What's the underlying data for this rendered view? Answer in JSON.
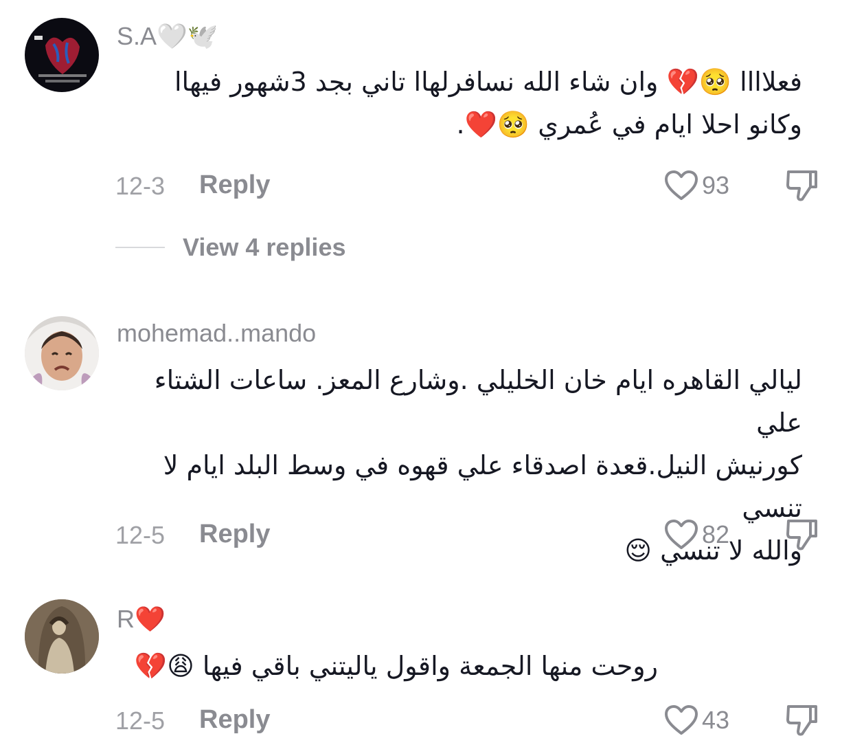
{
  "comments": [
    {
      "username": "S.A🤍🕊️",
      "text_line1": "فعلاااا 🥺💔 وان شاء الله نسافرلهاا تاني بجد 3شهور فيهاا",
      "text_line2": "وكانو احلا ايام في عُمري 🥺❤️.",
      "date": "12-3",
      "reply_label": "Reply",
      "likes": "93",
      "view_replies": "View 4 replies"
    },
    {
      "username": "mohemad..mando",
      "text_line1": "ليالي القاهره ايام خان الخليلي .وشارع المعز. ساعات الشتاء علي",
      "text_line2": "كورنيش النيل.قعدة اصدقاء علي قهوه في وسط البلد ايام لا تنسي",
      "text_line3": "والله لا تنسي 😌",
      "date": "12-5",
      "reply_label": "Reply",
      "likes": "82"
    },
    {
      "username": "R❤️",
      "text_line1": "روحت منها الجمعة واقول ياليتني باقي فيها 😩💔",
      "date": "12-5",
      "reply_label": "Reply",
      "likes": "43"
    }
  ],
  "icons": {
    "like": "heart-outline-icon",
    "dislike": "thumbs-down-icon"
  },
  "colors": {
    "text": "#161823",
    "muted": "#8a8b91"
  }
}
